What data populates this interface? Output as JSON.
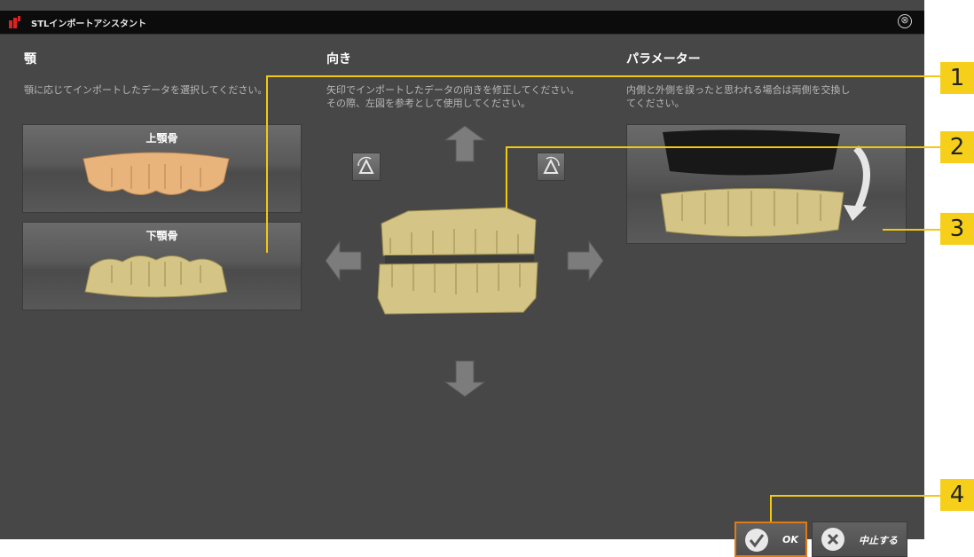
{
  "window": {
    "title": "STLインポートアシスタント",
    "close_symbol": "⊗"
  },
  "columns": {
    "jaw": {
      "title": "顎",
      "description": "顎に応じてインポートしたデータを選択してください。"
    },
    "orientation": {
      "title": "向き",
      "description": "矢印でインポートしたデータの向きを修正してください。\nその際、左図を参考として使用してください。"
    },
    "parameters": {
      "title": "パラメーター",
      "description": "内側と外側を誤ったと思われる場合は両側を交換し\nてください。"
    }
  },
  "jaw_options": [
    {
      "label": "上顎骨",
      "color": "#e8b27a"
    },
    {
      "label": "下顎骨",
      "color": "#d4c485"
    }
  ],
  "model_color": "#d4c485",
  "callouts": [
    "1",
    "2",
    "3",
    "4"
  ],
  "buttons": {
    "ok": "OK",
    "cancel": "中止する"
  },
  "colors": {
    "accent": "#f5cf1a",
    "ok_border": "#e07a16"
  }
}
